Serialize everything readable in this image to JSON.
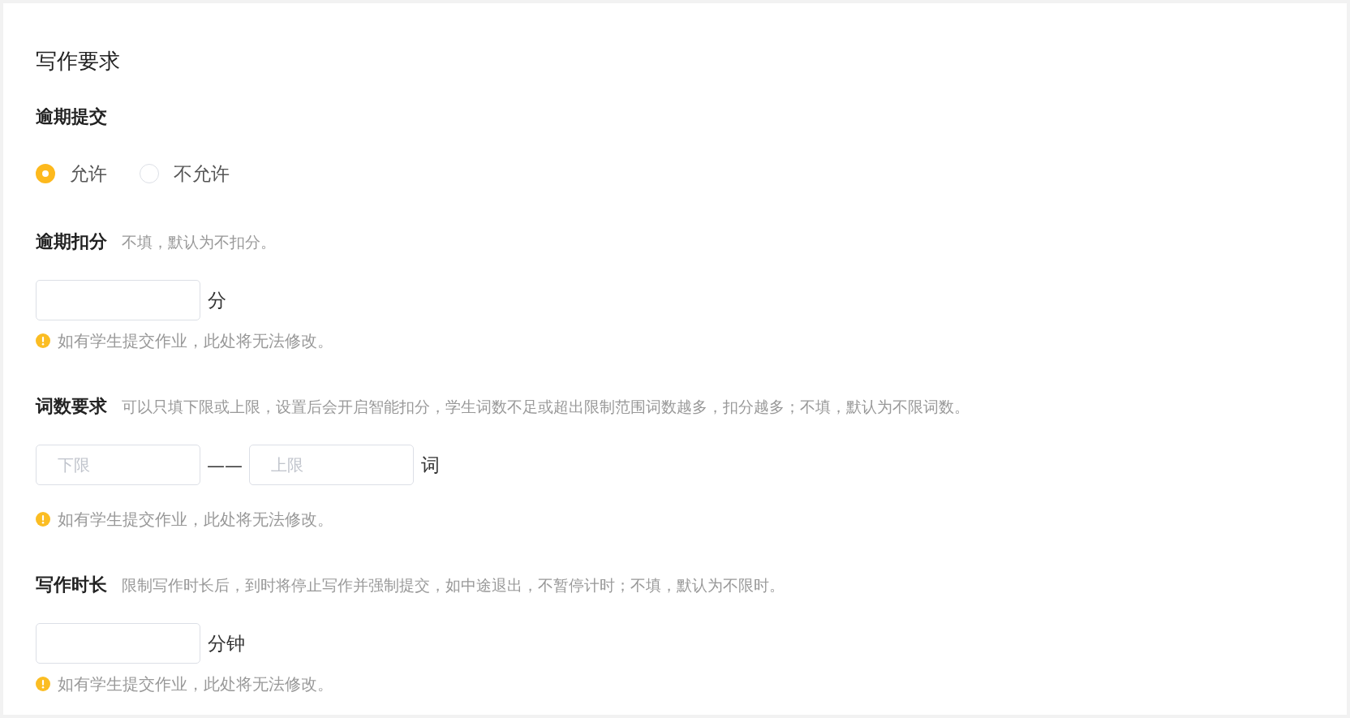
{
  "title": "写作要求",
  "sections": [
    {
      "kind": "radio",
      "label": "逾期提交",
      "options": [
        {
          "label": "允许",
          "selected": true
        },
        {
          "label": "不允许",
          "selected": false
        }
      ]
    },
    {
      "kind": "single",
      "label": "逾期扣分",
      "hint": "不填，默认为不扣分。",
      "unit": "分",
      "warning": "如有学生提交作业，此处将无法修改。"
    },
    {
      "kind": "range",
      "label": "词数要求",
      "hint": "可以只填下限或上限，设置后会开启智能扣分，学生词数不足或超出限制范围词数越多，扣分越多；不填，默认为不限词数。",
      "fields": [
        {
          "placeholder": "下限"
        },
        {
          "placeholder": "上限"
        }
      ],
      "separator": "——",
      "unit": "词",
      "warning": "如有学生提交作业，此处将无法修改。"
    },
    {
      "kind": "single",
      "label": "写作时长",
      "hint": "限制写作时长后，到时将停止写作并强制提交，如中途退出，不暂停计时；不填，默认为不限时。",
      "unit": "分钟",
      "warning": "如有学生提交作业，此处将无法修改。"
    }
  ]
}
